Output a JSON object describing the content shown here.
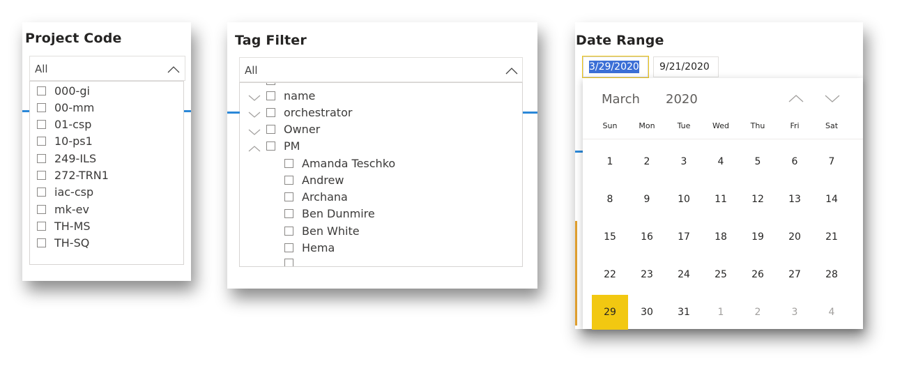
{
  "project_code": {
    "title": "Project Code",
    "dropdown_value": "All",
    "items": [
      "000-gi",
      "00-mm",
      "01-csp",
      "10-ps1",
      "249-ILS",
      "272-TRN1",
      "iac-csp",
      "mk-ev",
      "TH-MS",
      "TH-SQ"
    ]
  },
  "tag_filter": {
    "title": "Tag Filter",
    "dropdown_value": "All",
    "groups": [
      {
        "label": "name",
        "expanded": false
      },
      {
        "label": "orchestrator",
        "expanded": false
      },
      {
        "label": "Owner",
        "expanded": false
      },
      {
        "label": "PM",
        "expanded": true
      }
    ],
    "children": [
      "Amanda Teschko",
      "Andrew",
      "Archana",
      "Ben Dunmire",
      "Ben White",
      "Hema"
    ]
  },
  "date_range": {
    "title": "Date Range",
    "start_date": "3/29/2020",
    "end_date": "9/21/2020",
    "calendar": {
      "month": "March",
      "year": "2020",
      "weekdays": [
        "Sun",
        "Mon",
        "Tue",
        "Wed",
        "Thu",
        "Fri",
        "Sat"
      ],
      "weeks": [
        [
          "1",
          "2",
          "3",
          "4",
          "5",
          "6",
          "7"
        ],
        [
          "8",
          "9",
          "10",
          "11",
          "12",
          "13",
          "14"
        ],
        [
          "15",
          "16",
          "17",
          "18",
          "19",
          "20",
          "21"
        ],
        [
          "22",
          "23",
          "24",
          "25",
          "26",
          "27",
          "28"
        ],
        [
          "29",
          "30",
          "31",
          "1",
          "2",
          "3",
          "4"
        ]
      ],
      "selected_day": "29"
    }
  },
  "colors": {
    "accent_blue": "#2b88d8",
    "selected_day": "#f2c811",
    "text_selection": "#3b6fd6"
  },
  "icons": {
    "dropdown_chevron": "chevron-up-icon",
    "collapsed_group": "chevron-down-icon",
    "expanded_group": "chevron-up-icon",
    "calendar_prev": "chevron-up-icon",
    "calendar_next": "chevron-down-icon"
  }
}
